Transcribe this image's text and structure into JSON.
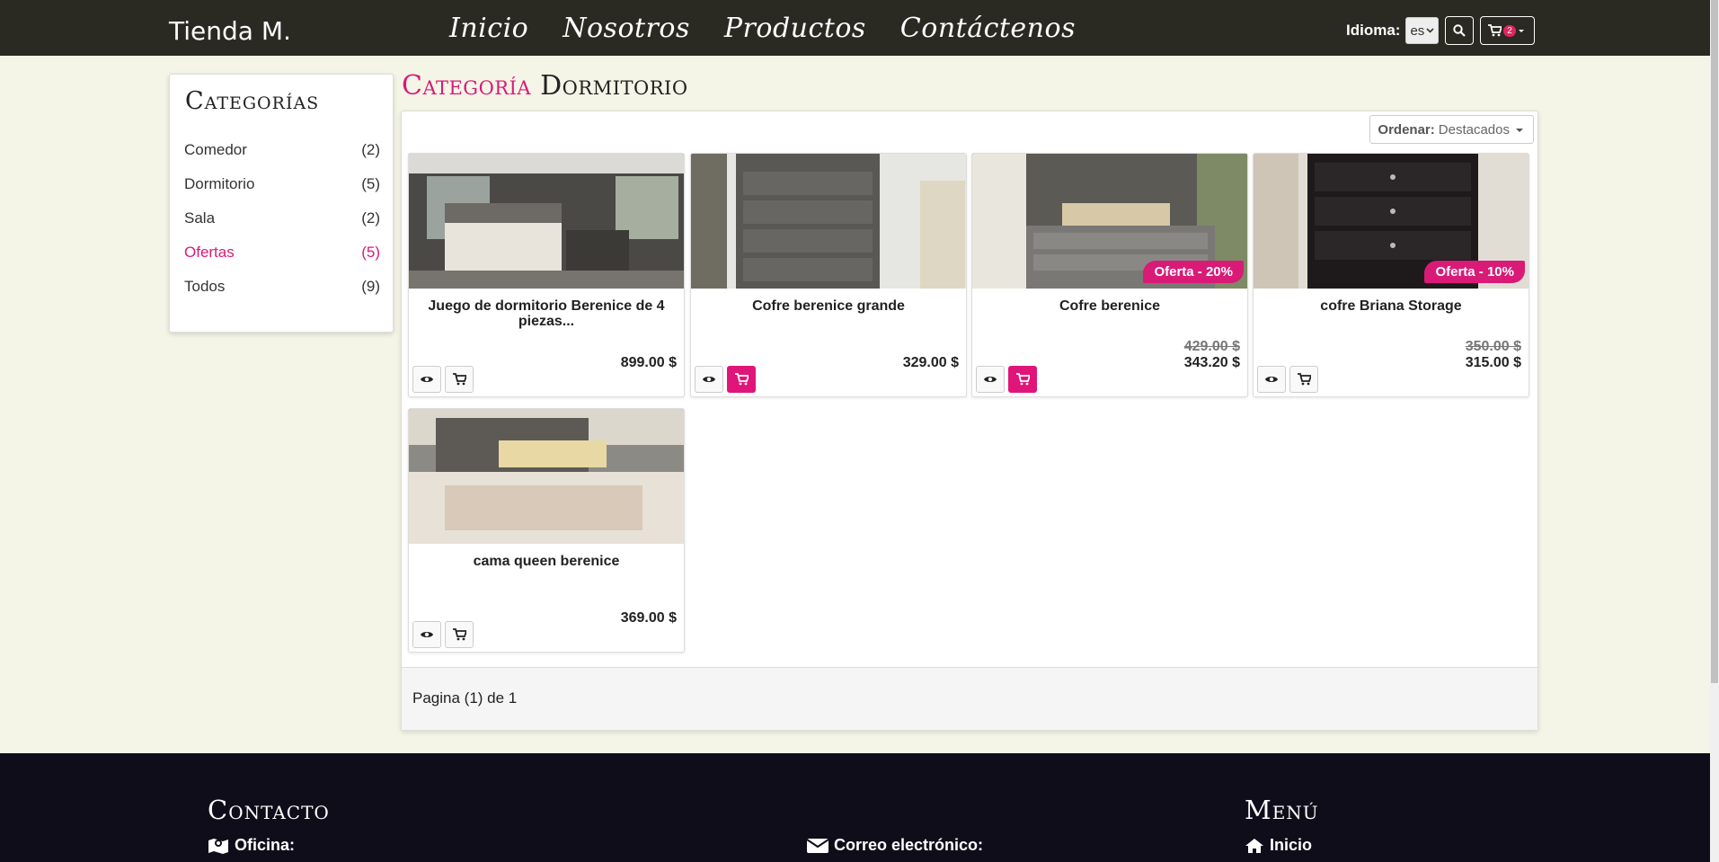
{
  "brand": "Tienda M.",
  "nav": [
    "Inicio",
    "Nosotros",
    "Productos",
    "Contáctenos"
  ],
  "lang": {
    "label": "Idioma:",
    "value": "es"
  },
  "cart_count": "2",
  "sidebar": {
    "title": "Categorías",
    "items": [
      {
        "label": "Comedor",
        "count": "(2)"
      },
      {
        "label": "Dormitorio",
        "count": "(5)"
      },
      {
        "label": "Sala",
        "count": "(2)"
      },
      {
        "label": "Ofertas",
        "count": "(5)"
      },
      {
        "label": "Todos",
        "count": "(9)"
      }
    ]
  },
  "heading": {
    "prefix": "Categoría",
    "name": "Dormitorio"
  },
  "sort": {
    "label": "Ordenar:",
    "value": "Destacados"
  },
  "products": [
    {
      "name": "Juego de dormitorio Berenice de 4 piezas...",
      "price": "899.00 $"
    },
    {
      "name": "Cofre berenice grande",
      "price": "329.00 $"
    },
    {
      "name": "Cofre berenice",
      "old_price": "429.00 $",
      "price": "343.20 $",
      "offer": "Oferta - 20%"
    },
    {
      "name": "cofre Briana Storage",
      "old_price": "350.00 $",
      "price": "315.00 $",
      "offer": "Oferta - 10%"
    },
    {
      "name": "cama queen berenice",
      "price": "369.00 $"
    }
  ],
  "pager": "Pagina (1) de 1",
  "footer": {
    "contact_title": "Contacto",
    "office_label": "Oficina:",
    "email_label": "Correo electrónico:",
    "menu_title": "Menú",
    "menu_first": "Inicio"
  },
  "colors": {
    "accent": "#d91a77",
    "navbar": "#2a2922",
    "footer": "#0f0d1a",
    "background": "#f4f5e6"
  }
}
